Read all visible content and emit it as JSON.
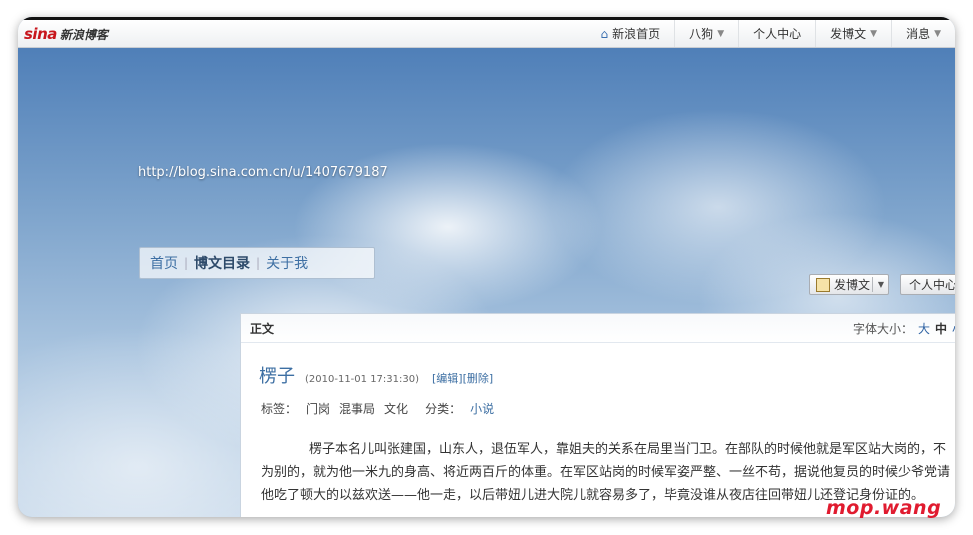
{
  "logo": {
    "sina": "sina",
    "text": "新浪博客"
  },
  "topnav": {
    "home": "新浪首页",
    "user": "八狗",
    "center": "个人中心",
    "post": "发博文",
    "msg": "消息"
  },
  "blog": {
    "url": "http://blog.sina.com.cn/u/1407679187",
    "nav": {
      "home": "首页",
      "catalog": "博文目录",
      "about": "关于我"
    }
  },
  "actions": {
    "post": "发博文",
    "center": "个人中心"
  },
  "article": {
    "section": "正文",
    "fontsize": {
      "label": "字体大小：",
      "large": "大",
      "medium": "中",
      "small": "小"
    },
    "title": "楞子",
    "time": "(2010-11-01 17:31:30)",
    "ops": "[编辑][删除]",
    "tags_label": "标签：",
    "tags": [
      "门岗",
      "混事局",
      "文化"
    ],
    "category_label": "分类：",
    "category": "小说",
    "paragraph": "楞子本名儿叫张建国，山东人，退伍军人，靠姐夫的关系在局里当门卫。在部队的时候他就是军区站大岗的，不为别的，就为他一米九的身高、将近两百斤的体重。在军区站岗的时候军姿严整、一丝不苟，据说他复员的时候少爷党请他吃了顿大的以兹欢送——他一走，以后带妞儿进大院儿就容易多了，毕竟没谁从夜店往回带妞儿还登记身份证的。"
  },
  "watermark": "mop.wang"
}
